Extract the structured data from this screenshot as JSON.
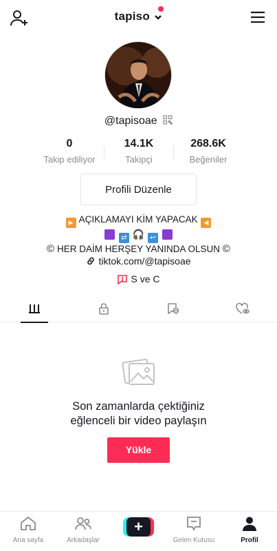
{
  "header": {
    "username": "tapiso",
    "notification_color": "#fe2c55"
  },
  "profile": {
    "handle": "@tapisoae",
    "stats": [
      {
        "value": "0",
        "label": "Takip ediliyor"
      },
      {
        "value": "14.1K",
        "label": "Takipçi"
      },
      {
        "value": "268.6K",
        "label": "Beğeniler"
      }
    ],
    "edit_button": "Profili Düzenle",
    "bio": {
      "line1": "AÇIKLAMAYI KİM YAPACAK",
      "line3": "HER DAİM HERŞEY YANINDA OLSUN"
    },
    "link": "tiktok.com/@tapisoae",
    "group": "S ve C"
  },
  "tabs": [
    {
      "name": "videos-tab",
      "icon": "grid-bars-icon",
      "active": true
    },
    {
      "name": "private-tab",
      "icon": "lock-icon"
    },
    {
      "name": "reposts-tab",
      "icon": "reposts-icon"
    },
    {
      "name": "liked-tab",
      "icon": "heart-hidden-icon"
    }
  ],
  "empty_state": {
    "message_line1": "Son zamanlarda çektiğiniz",
    "message_line2": "eğlenceli bir video paylaşın",
    "upload_button": "Yükle"
  },
  "bottom_nav": [
    {
      "label": "Ana sayfa",
      "icon": "home-icon"
    },
    {
      "label": "Arkadaşlar",
      "icon": "friends-icon"
    },
    {
      "label": "",
      "icon": "create-plus-icon"
    },
    {
      "label": "Gelen Kutusu",
      "icon": "inbox-icon"
    },
    {
      "label": "Profil",
      "icon": "profile-icon",
      "active": true
    }
  ],
  "colors": {
    "accent": "#fe2c55",
    "cyan": "#25f4ee",
    "text": "#161823",
    "muted": "#8a8b91"
  }
}
